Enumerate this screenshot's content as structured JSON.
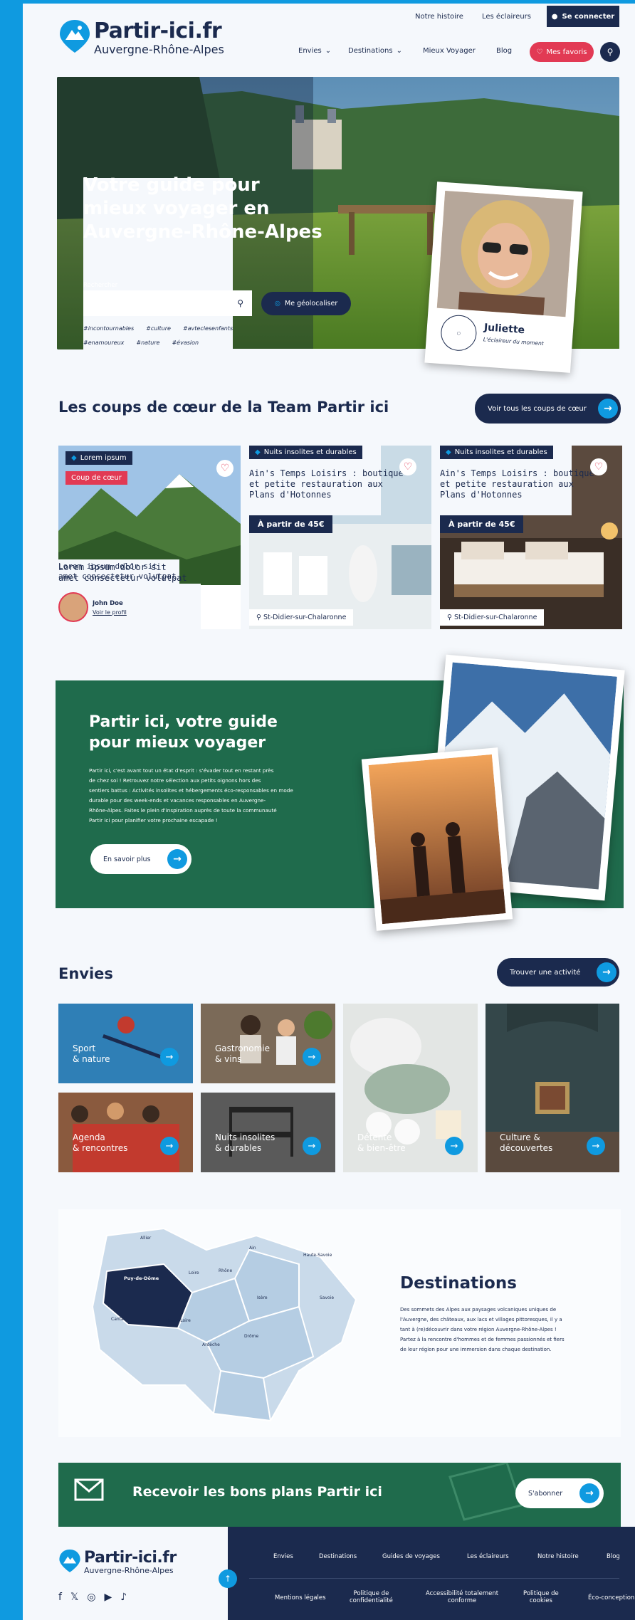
{
  "header": {
    "brand": "Partir-ici.fr",
    "brand_sub": "Auvergne-Rhône-Alpes",
    "util_links": [
      "Notre histoire",
      "Les éclaireurs"
    ],
    "login": "Se connecter",
    "nav": [
      "Envies",
      "Destinations",
      "Mieux Voyager",
      "Blog"
    ],
    "favorites": "Mes favoris"
  },
  "hero": {
    "title_lines": [
      "Votre guide pour",
      "mieux voyager en",
      "Auvergne-Rhône-Alpes"
    ],
    "search_label": "Rechercher",
    "search_placeholder": "",
    "geo_button": "Me géolocaliser",
    "tags_line1": [
      "#incontournables",
      "#culture",
      "#avteclesenfants"
    ],
    "tags_line2": [
      "#enamoureux",
      "#nature",
      "#évasion"
    ],
    "polaroid_name": "Juliette",
    "polaroid_role": "L'éclaireur du moment"
  },
  "favorites_section": {
    "title": "Les coups de cœur de la Team Partir ici",
    "cta": "Voir tous les coups de cœur",
    "card1": {
      "tag": "Lorem ipsum",
      "badge": "Coup de cœur",
      "text_lines": [
        "Lorem ipsum dolor sit",
        "amet consectetur volutpat"
      ],
      "author": "John Doe",
      "profile_link": "Voir le profil"
    },
    "card2": {
      "tag": "Nuits insolites et durables",
      "title_lines": [
        "Ain's Temps Loisirs : boutique",
        "et petite restauration aux",
        "Plans d'Hotonnes"
      ],
      "price": "À partir de 45€",
      "location": "St-Didier-sur-Chalaronne"
    },
    "card3": {
      "tag": "Nuits insolites et durables",
      "title_lines": [
        "Ain's Temps Loisirs : boutique",
        "et petite restauration aux",
        "Plans d'Hotonnes"
      ],
      "price": "À partir de 45€",
      "location": "St-Didier-sur-Chalaronne"
    }
  },
  "guide": {
    "title_lines": [
      "Partir ici, votre guide",
      "pour mieux voyager"
    ],
    "body_lines": [
      "Partir ici, c'est avant tout un état d'esprit : s'évader tout en restant près",
      "de chez soi ! Retrouvez notre sélection aux petits oignons hors des",
      "sentiers battus : Activités insolites et hébergements éco-responsables en mode",
      "durable pour des week-ends et vacances responsables en Auvergne-",
      "Rhône-Alpes. Faites le plein d'inspiration auprès de toute la communauté",
      "Partir ici pour planifier votre prochaine escapade !"
    ],
    "cta": "En savoir plus"
  },
  "envies": {
    "title": "Envies",
    "cta": "Trouver une activité",
    "tiles": [
      {
        "lines": [
          "Sport",
          "& nature"
        ]
      },
      {
        "lines": [
          "Gastronomie",
          "& vins"
        ]
      },
      {
        "lines": [
          "Détente",
          "& bien-être"
        ]
      },
      {
        "lines": [
          "Culture &",
          "découvertes"
        ]
      },
      {
        "lines": [
          "Agenda",
          "& rencontres"
        ]
      },
      {
        "lines": [
          "Nuits insolites",
          "& durables"
        ]
      }
    ]
  },
  "destinations": {
    "title": "Destinations",
    "body_lines": [
      "Des sommets des Alpes aux paysages volcaniques uniques de",
      "l'Auvergne, des châteaux, aux lacs et villages pittoresques, il y a",
      "tant à (re)découvrir dans votre région Auvergne-Rhône-Alpes !",
      "Partez à la rencontre d'hommes et de femmes passionnés et fiers",
      "de leur région pour une immersion dans chaque destination."
    ],
    "regions": [
      "Allier",
      "Puy-de-Dôme",
      "Loire",
      "Rhône",
      "Ain",
      "Haute-Savoie",
      "Cantal",
      "Haute-Loire",
      "Isère",
      "Savoie",
      "Drôme",
      "Ardèche"
    ]
  },
  "newsletter": {
    "title": "Recevoir les bons plans Partir ici",
    "cta": "S'abonner"
  },
  "footer": {
    "brand": "Partir-ici.fr",
    "brand_sub": "Auvergne-Rhône-Alpes",
    "nav": [
      "Envies",
      "Destinations",
      "Guides de voyages",
      "Les éclaireurs",
      "Notre histoire",
      "Blog"
    ],
    "legal": [
      {
        "l1": "Mentions légales",
        "l2": ""
      },
      {
        "l1": "Politique de",
        "l2": "confidentialité"
      },
      {
        "l1": "Accessibilité totalement",
        "l2": "conforme"
      },
      {
        "l1": "Politique de",
        "l2": "cookies"
      },
      {
        "l1": "Éco-conception",
        "l2": ""
      }
    ],
    "socials": [
      "facebook-icon",
      "x-icon",
      "instagram-icon",
      "youtube-icon",
      "tiktok-icon"
    ]
  },
  "colors": {
    "navy": "#1b2a4e",
    "blue": "#0f9ae0",
    "green": "#1f6b4c",
    "red": "#e23a54"
  }
}
